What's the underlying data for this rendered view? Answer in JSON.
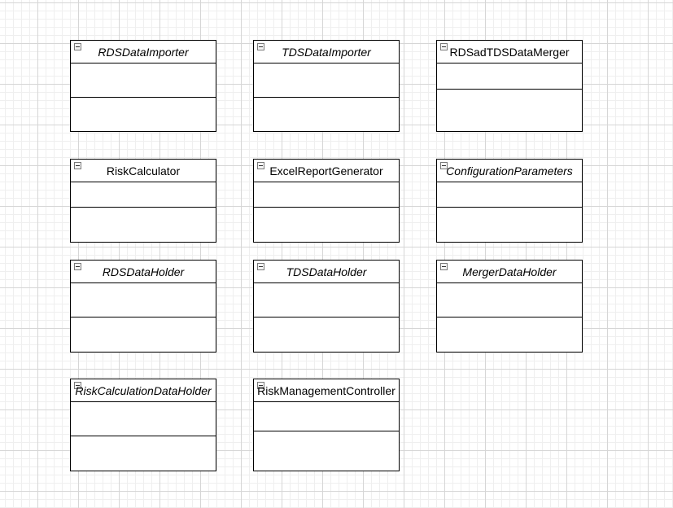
{
  "diagram": {
    "classes": [
      {
        "name": "RDSDataImporter",
        "abstract": true
      },
      {
        "name": "TDSDataImporter",
        "abstract": true
      },
      {
        "name": "RDSadTDSDataMerger",
        "abstract": false
      },
      {
        "name": "RiskCalculator",
        "abstract": false
      },
      {
        "name": "ExcelReportGenerator",
        "abstract": false
      },
      {
        "name": "ConfigurationParameters",
        "abstract": true
      },
      {
        "name": "RDSDataHolder",
        "abstract": true
      },
      {
        "name": "TDSDataHolder",
        "abstract": true
      },
      {
        "name": "MergerDataHolder",
        "abstract": true
      },
      {
        "name": "RiskCalculationDataHolder",
        "abstract": true
      },
      {
        "name": "RiskManagementController",
        "abstract": false
      }
    ]
  }
}
